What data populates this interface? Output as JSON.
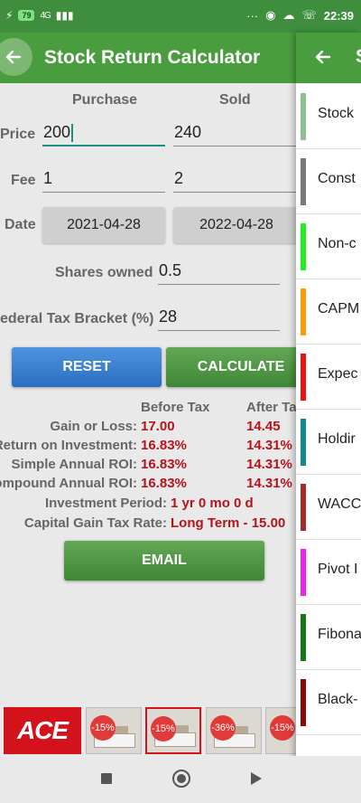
{
  "status_bar": {
    "battery": "79",
    "network": "4G",
    "dots": "···",
    "time": "22:39"
  },
  "toolbar": {
    "title": "Stock Return Calculator"
  },
  "columns": {
    "purchase": "Purchase",
    "sold": "Sold"
  },
  "form": {
    "price_label": "Price",
    "price_purchase": "200",
    "price_sold": "240",
    "fee_label": "Fee",
    "fee_purchase": "1",
    "fee_sold": "2",
    "date_label": "Date",
    "date_purchase": "2021-04-28",
    "date_sold": "2022-04-28",
    "shares_label": "Shares owned",
    "shares_value": "0.5",
    "tax_label": "ederal Tax Bracket (%)",
    "tax_value": "28"
  },
  "buttons": {
    "reset": "RESET",
    "calculate": "CALCULATE",
    "email": "EMAIL"
  },
  "results": {
    "before_tax_head": "Before Tax",
    "after_tax_head": "After Ta",
    "rows": [
      {
        "label": "Gain or Loss:",
        "before": "17.00",
        "after": "14.45"
      },
      {
        "label": "Return on Investment:",
        "before": "16.83%",
        "after": "14.31%"
      },
      {
        "label": "Simple Annual ROI:",
        "before": "16.83%",
        "after": "14.31%"
      },
      {
        "label": "ompound Annual ROI:",
        "before": "16.83%",
        "after": "14.31%"
      }
    ],
    "period_label": "Investment Period:",
    "period_value": "1 yr  0 mo  0 d",
    "cgt_label": "Capital Gain Tax Rate:",
    "cgt_value": "Long Term - 15.00"
  },
  "ads": {
    "logo": "ACE",
    "discounts": [
      "-15%",
      "-15%",
      "-36%",
      "-15%"
    ]
  },
  "drawer": {
    "header_letter": "S",
    "items": [
      {
        "label": "Stock",
        "color": "#8fc08f"
      },
      {
        "label": "Const",
        "color": "#7a7a7a"
      },
      {
        "label": "Non-c",
        "color": "#22ee22"
      },
      {
        "label": "CAPM",
        "color": "#ff9900"
      },
      {
        "label": "Expec",
        "color": "#ee1111"
      },
      {
        "label": "Holdir",
        "color": "#138a8a"
      },
      {
        "label": "WACC",
        "color": "#a52a2a"
      },
      {
        "label": "Pivot I",
        "color": "#ee22ee"
      },
      {
        "label": "Fibona",
        "color": "#137a13"
      },
      {
        "label": "Black-",
        "color": "#8b0a0a"
      }
    ]
  }
}
